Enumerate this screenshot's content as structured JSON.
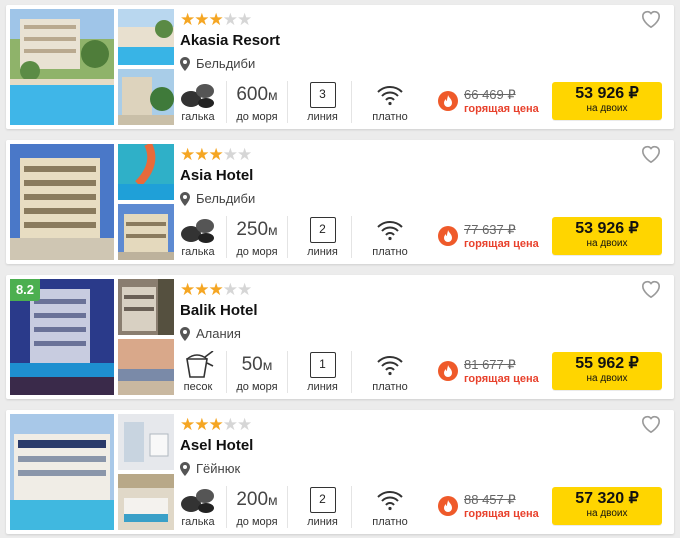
{
  "colors": {
    "accent_yellow": "#ffd500",
    "star_filled": "#f5a623",
    "star_empty": "#d6d6d6",
    "hot_red": "#e8412c",
    "rating_green": "#4caf50"
  },
  "hotels": [
    {
      "stars": 3,
      "max_stars": 5,
      "name": "Akasia Resort",
      "location": "Бельдиби",
      "rating_badge": "",
      "beach_icon": "pebbles-icon",
      "beach_label": "галька",
      "distance_value": "600",
      "distance_unit": "м",
      "distance_label": "до моря",
      "line_number": "3",
      "line_label": "линия",
      "wifi_label": "платно",
      "old_price": "66 469 ₽",
      "hot_label": "горящая цена",
      "price": "53 926 ₽",
      "price_sub": "на двоих"
    },
    {
      "stars": 3,
      "max_stars": 5,
      "name": "Asia Hotel",
      "location": "Бельдиби",
      "rating_badge": "",
      "beach_icon": "pebbles-icon",
      "beach_label": "галька",
      "distance_value": "250",
      "distance_unit": "м",
      "distance_label": "до моря",
      "line_number": "2",
      "line_label": "линия",
      "wifi_label": "платно",
      "old_price": "77 637 ₽",
      "hot_label": "горящая цена",
      "price": "53 926 ₽",
      "price_sub": "на двоих"
    },
    {
      "stars": 3,
      "max_stars": 5,
      "name": "Balik Hotel",
      "location": "Алания",
      "rating_badge": "8.2",
      "beach_icon": "sand-bucket-icon",
      "beach_label": "песок",
      "distance_value": "50",
      "distance_unit": "м",
      "distance_label": "до моря",
      "line_number": "1",
      "line_label": "линия",
      "wifi_label": "платно",
      "old_price": "81 677 ₽",
      "hot_label": "горящая цена",
      "price": "55 962 ₽",
      "price_sub": "на двоих"
    },
    {
      "stars": 3,
      "max_stars": 5,
      "name": "Asel Hotel",
      "location": "Гёйнюк",
      "rating_badge": "",
      "beach_icon": "pebbles-icon",
      "beach_label": "галька",
      "distance_value": "200",
      "distance_unit": "м",
      "distance_label": "до моря",
      "line_number": "2",
      "line_label": "линия",
      "wifi_label": "платно",
      "old_price": "88 457 ₽",
      "hot_label": "горящая цена",
      "price": "57 320 ₽",
      "price_sub": "на двоих"
    }
  ]
}
